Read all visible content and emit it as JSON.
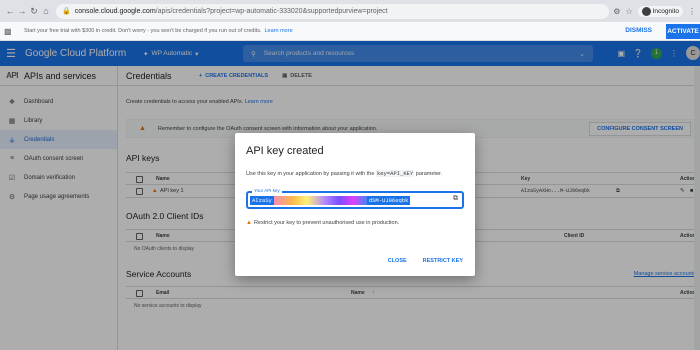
{
  "browser": {
    "url_host": "console.cloud.google.com",
    "url_path": "/apis/credentials?project=wp-automatic-333020&supportedpurview=project",
    "incognito_label": "Incognito"
  },
  "trial_banner": {
    "text": "Start your free trial with $300 in credit. Don't worry - you won't be charged if you run out of credits.",
    "learn_more": "Learn more",
    "dismiss": "DISMISS",
    "activate": "ACTIVATE"
  },
  "header": {
    "platform": "Google Cloud Platform",
    "project": "WP Automatic",
    "search_placeholder": "Search products and resources",
    "avatar_letter": "C",
    "notification_count": "1",
    "brand_color": "#1a73e8"
  },
  "sidebar": {
    "title": "APIs and services",
    "title_icon": "API",
    "items": [
      {
        "label": "Dashboard",
        "icon": "dashboard-icon"
      },
      {
        "label": "Library",
        "icon": "library-icon"
      },
      {
        "label": "Credentials",
        "icon": "key-icon",
        "active": true
      },
      {
        "label": "OAuth consent screen",
        "icon": "consent-icon"
      },
      {
        "label": "Domain verification",
        "icon": "checkbox-icon"
      },
      {
        "label": "Page usage agreements",
        "icon": "settings-icon"
      }
    ]
  },
  "main": {
    "title": "Credentials",
    "create_label": "CREATE CREDENTIALS",
    "delete_label": "DELETE",
    "intro": "Create credentials to access your enabled APIs.",
    "intro_link": "Learn more",
    "warning": "Remember to configure the OAuth consent screen with information about your application.",
    "consent_button": "CONFIGURE CONSENT SCREEN",
    "api_keys": {
      "heading": "API keys",
      "columns": [
        "Name",
        "Key",
        "Actions"
      ],
      "rows": [
        {
          "name": "API key 1",
          "key": "AIzaSyAXHo...M-UJ96eqbk"
        }
      ]
    },
    "oauth": {
      "heading": "OAuth 2.0 Client IDs",
      "columns": [
        "Name",
        "Client ID",
        "Actions"
      ],
      "empty": "No OAuth clients to display"
    },
    "service_accounts": {
      "heading": "Service Accounts",
      "manage_link": "Manage service accounts",
      "columns": [
        "Email",
        "Name",
        "Actions"
      ],
      "empty": "No service accounts to display"
    }
  },
  "dialog": {
    "title": "API key created",
    "description_pre": "Use this key in your application by passing it with the",
    "param": "key=API_KEY",
    "description_post": "parameter.",
    "field_label": "Your API key",
    "key_start": "AIzaSy",
    "key_end": "dSM-UJ96eqbk",
    "restrict_note": "Restrict your key to prevent unauthorised use in production.",
    "close": "CLOSE",
    "restrict_key": "RESTRICT KEY"
  }
}
